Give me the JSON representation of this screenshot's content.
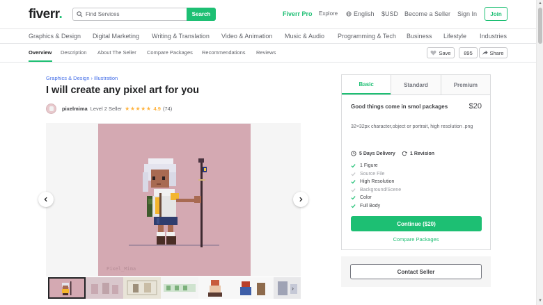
{
  "header": {
    "logo": "fiverr",
    "logo_dot": ".",
    "search_placeholder": "Find Services",
    "search_button": "Search",
    "fiverr_pro": "Fiverr Pro",
    "explore": "Explore",
    "language": "English",
    "currency": "$USD",
    "become_seller": "Become a Seller",
    "sign_in": "Sign In",
    "join": "Join"
  },
  "categories": [
    "Graphics & Design",
    "Digital Marketing",
    "Writing & Translation",
    "Video & Animation",
    "Music & Audio",
    "Programming & Tech",
    "Business",
    "Lifestyle",
    "Industries"
  ],
  "tabs": {
    "items": [
      "Overview",
      "Description",
      "About The Seller",
      "Compare Packages",
      "Recommendations",
      "Reviews"
    ],
    "active": "Overview",
    "save_label": "Save",
    "save_count": "895",
    "share_label": "Share"
  },
  "gig": {
    "breadcrumb": [
      "Graphics & Design",
      "Illustration"
    ],
    "breadcrumb_sep": "›",
    "title": "I will create any pixel art for you",
    "seller_name": "pixelmima",
    "seller_level": "Level 2 Seller",
    "stars": "★★★★★",
    "rating": "4.9",
    "review_count": "(74)",
    "watermark": "Pixel_Mima"
  },
  "packages": {
    "tabs": [
      "Basic",
      "Standard",
      "Premium"
    ],
    "active": "Basic",
    "name": "Good things come in smol packages",
    "price": "$20",
    "description": "32×32px character,object or portrait, high resolution .png",
    "delivery": "5 Days Delivery",
    "revisions": "1 Revision",
    "features": [
      {
        "label": "1 Figure",
        "included": true
      },
      {
        "label": "Source File",
        "included": false
      },
      {
        "label": "High Resolution",
        "included": true
      },
      {
        "label": "Background/Scene",
        "included": false
      },
      {
        "label": "Color",
        "included": true
      },
      {
        "label": "Full Body",
        "included": true
      }
    ],
    "continue_label": "Continue ($20)",
    "compare_label": "Compare Packages",
    "contact_label": "Contact Seller"
  },
  "colors": {
    "brand_green": "#1dbf73",
    "link_blue": "#446ee7",
    "star": "#ffb33e",
    "art_background": "#d4a9b2"
  }
}
